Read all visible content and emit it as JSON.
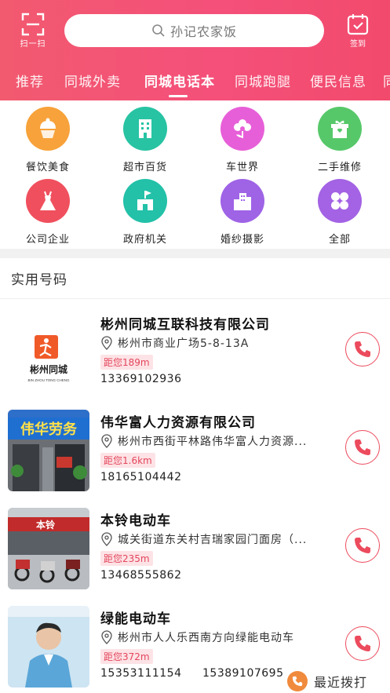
{
  "header": {
    "scan_label": "扫一扫",
    "search_placeholder": "孙记农家饭",
    "signin_label": "签到",
    "tabs": [
      {
        "label": "推荐"
      },
      {
        "label": "同城外卖"
      },
      {
        "label": "同城电话本",
        "active": true
      },
      {
        "label": "同城跑腿"
      },
      {
        "label": "便民信息"
      },
      {
        "label": "同"
      }
    ]
  },
  "categories": [
    {
      "label": "餐饮美食",
      "icon": "cake-icon",
      "color": "#f7a23a"
    },
    {
      "label": "超市百货",
      "icon": "building-icon",
      "color": "#27c3a3"
    },
    {
      "label": "车世界",
      "icon": "flower-icon",
      "color": "#e75fd8"
    },
    {
      "label": "二手维修",
      "icon": "gift-box-icon",
      "color": "#57c86a"
    },
    {
      "label": "公司企业",
      "icon": "dress-icon",
      "color": "#f0505e"
    },
    {
      "label": "政府机关",
      "icon": "castle-flag-icon",
      "color": "#22c1a8"
    },
    {
      "label": "婚纱摄影",
      "icon": "city-buildings-icon",
      "color": "#9f63e6"
    },
    {
      "label": "全部",
      "icon": "four-petal-grid-icon",
      "color": "#a363e4"
    }
  ],
  "section_title": "实用号码",
  "listings": [
    {
      "title": "彬州同城互联科技有限公司",
      "address": "彬州市商业广场5-8-13A",
      "distance": "距您189m",
      "phone": "13369102936",
      "phone2": "",
      "thumb": {
        "logo_text": "彬州同城",
        "logo_sub": "BIN ZHOU TONG CHENG",
        "accent": "#f05a28"
      }
    },
    {
      "title": "伟华富人力资源有限公司",
      "address": "彬州市西街平林路伟华富人力资源...",
      "distance": "距您1.6km",
      "phone": "18165104442",
      "phone2": "",
      "thumb": {
        "sign_text": "伟华劳务",
        "sign_color": "#1f6fd1"
      }
    },
    {
      "title": "本铃电动车",
      "address": "城关街道东关村吉瑞家园门面房（...",
      "distance": "距您235m",
      "phone": "13468555862",
      "phone2": "",
      "thumb": {
        "sign_text": "本铃",
        "sign_color": "#c22b2b"
      }
    },
    {
      "title": "绿能电动车",
      "address": "彬州市人人乐西南方向绿能电动车",
      "distance": "距您372m",
      "phone": "15353111154",
      "phone2": "15389107695",
      "thumb": {
        "sign_text": "",
        "sign_color": "#5aa6d8"
      }
    }
  ],
  "recent_call_label": "最近拨打",
  "colors": {
    "brand": "#f2506f",
    "call": "#ec4b5d"
  }
}
